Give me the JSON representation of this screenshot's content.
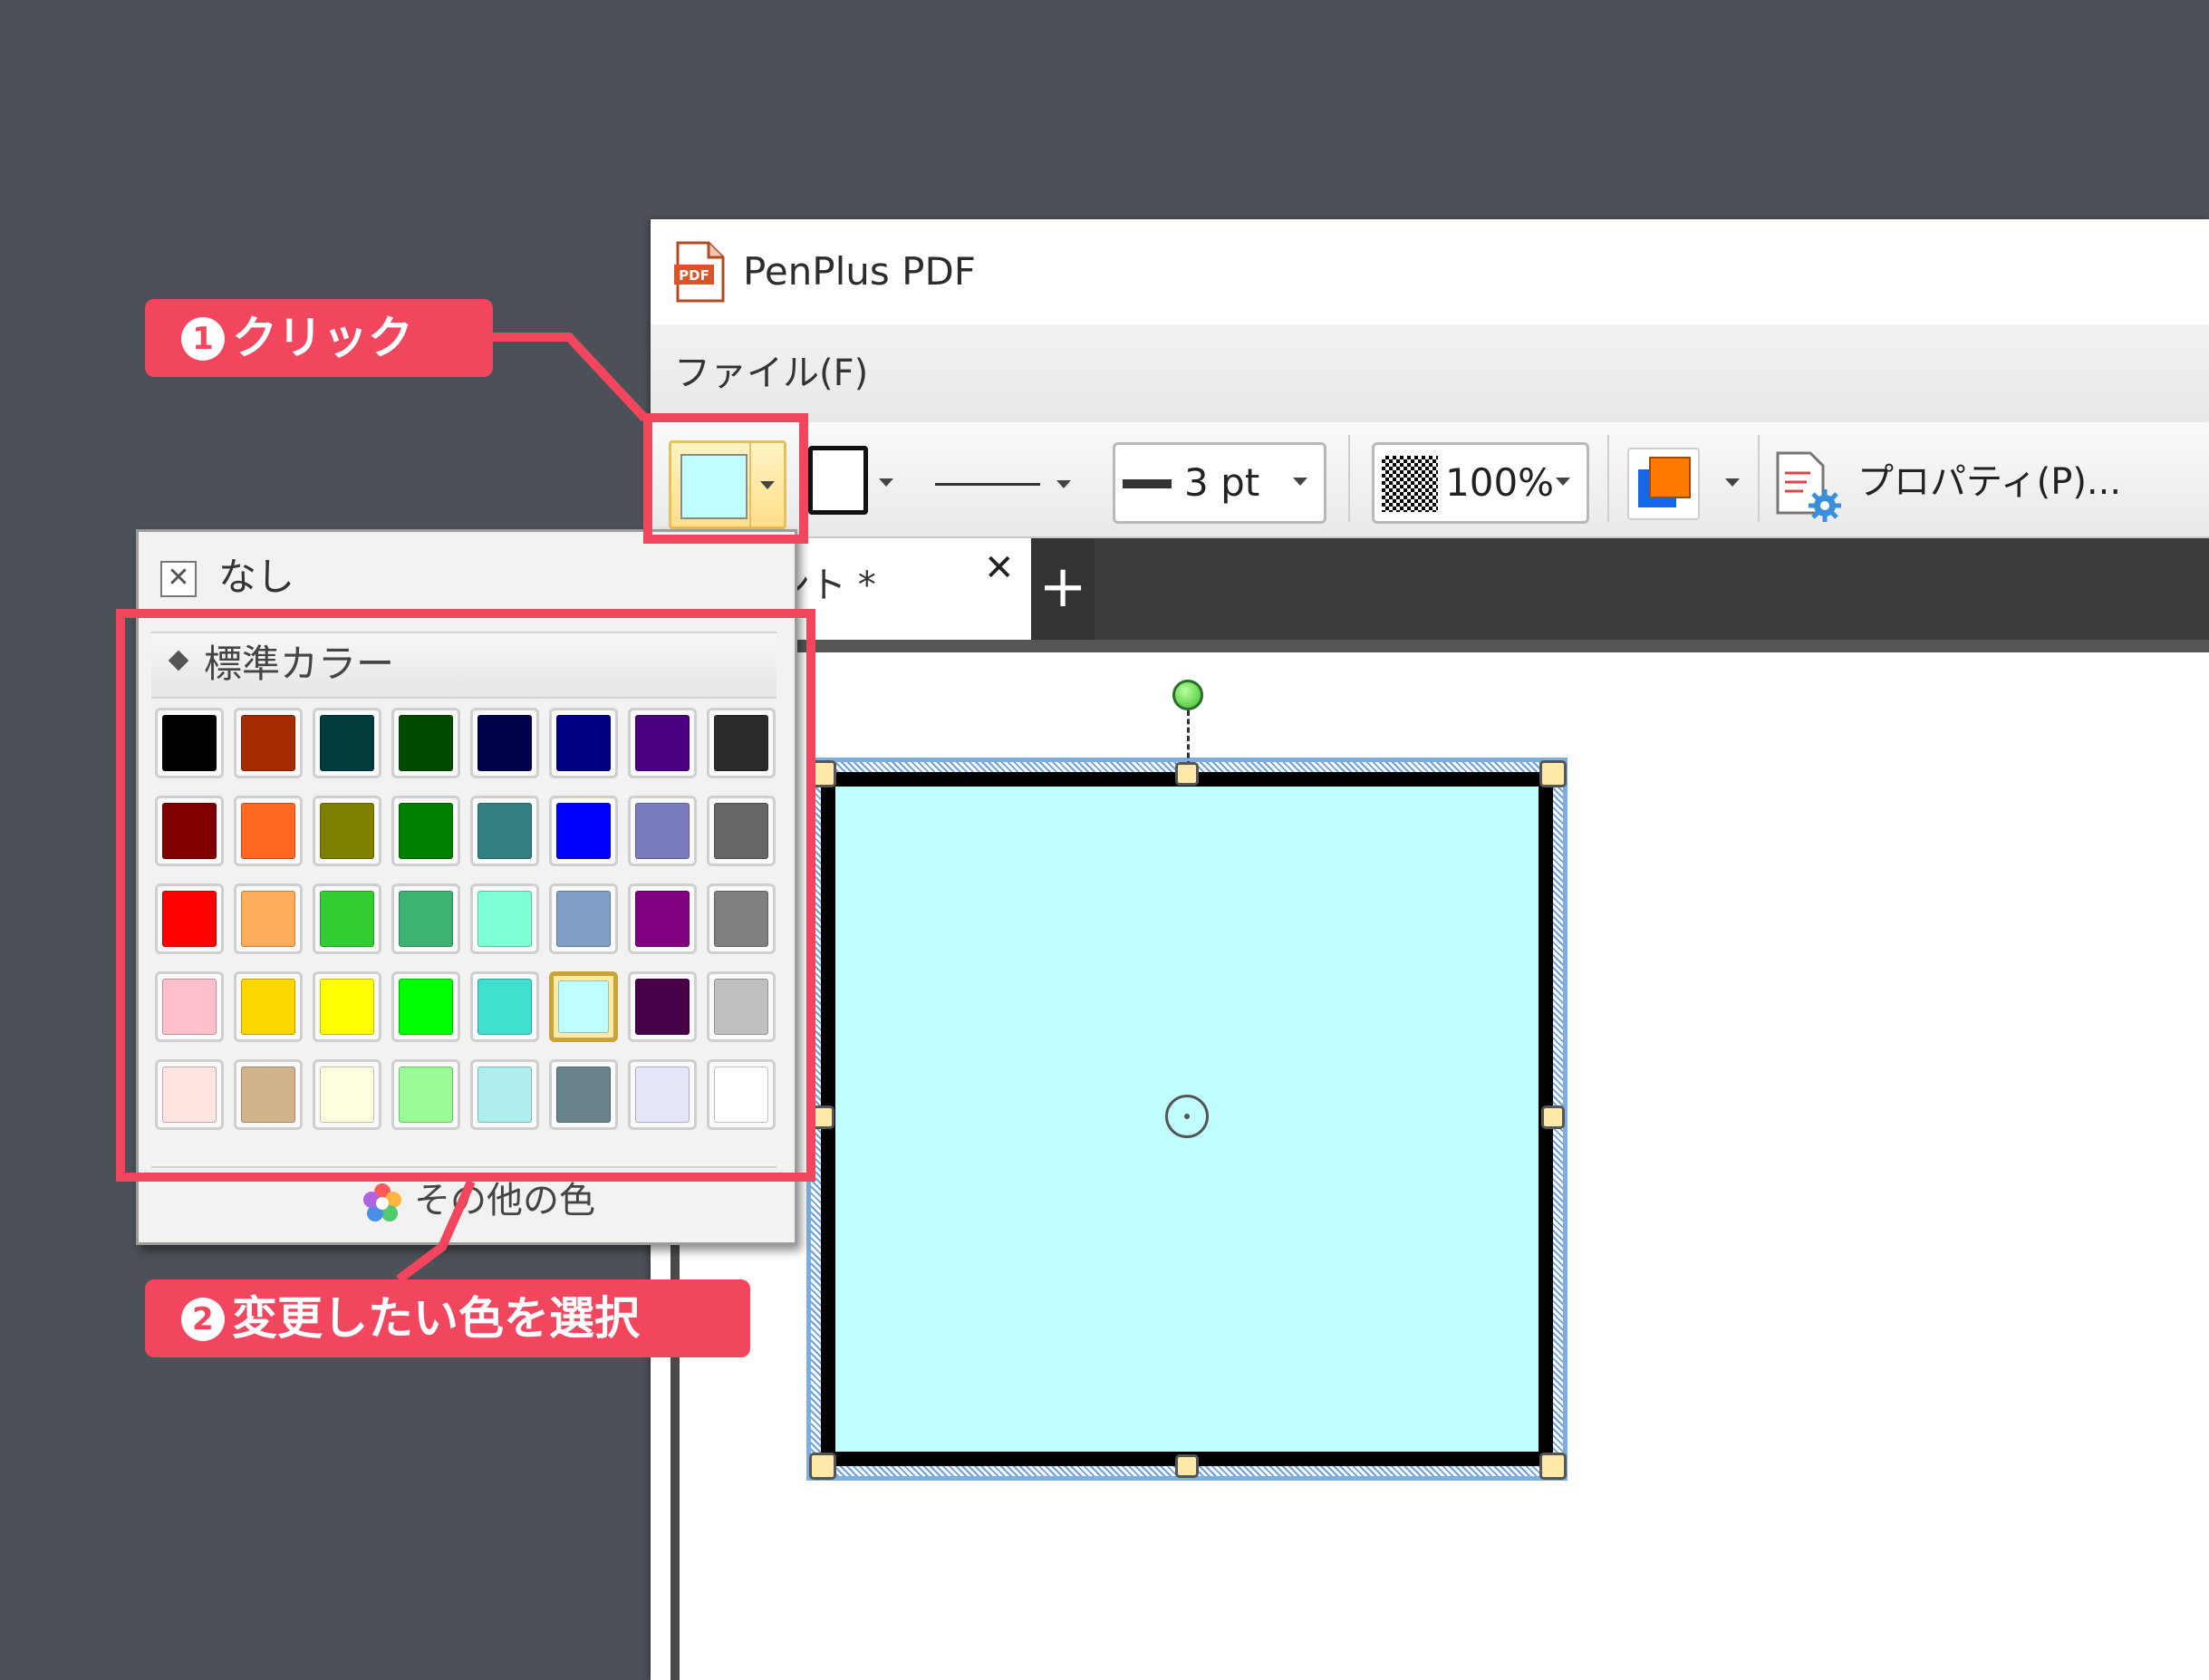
{
  "window": {
    "title": "PenPlus PDF",
    "app_icon": "pdf-app-icon"
  },
  "menu": {
    "file_label": "ファイル(F)"
  },
  "toolbar": {
    "fill_color": "#c0ffff",
    "line_color": "#000000",
    "line_width": "3 pt",
    "opacity": "100%",
    "properties_label": "プロパティ(P)..."
  },
  "tabs": {
    "document_label": "キュメント *",
    "close_glyph": "✕",
    "new_tab_glyph": "+"
  },
  "color_dropdown": {
    "none_label": "なし",
    "none_icon_glyph": "✕",
    "section_title": "標準カラー",
    "more_colors_label": "その他の色",
    "selected_color": "#c0ffff",
    "swatches": [
      [
        "#000000",
        "#a52a00",
        "#003c3c",
        "#004b00",
        "#00004b",
        "#000080",
        "#4b0082",
        "#2b2b2b"
      ],
      [
        "#800000",
        "#ff6820",
        "#808000",
        "#008000",
        "#338080",
        "#0000ff",
        "#7b7bc0",
        "#666666"
      ],
      [
        "#ff0000",
        "#ffad5b",
        "#32cd32",
        "#3cb371",
        "#7fffd4",
        "#7f9fc4",
        "#800080",
        "#7f7f7f"
      ],
      [
        "#ffc0cb",
        "#ffd700",
        "#ffff00",
        "#00ff00",
        "#40e0d0",
        "#c0ffff",
        "#480048",
        "#c0c0c0"
      ],
      [
        "#ffe4e1",
        "#d2b48c",
        "#ffffe0",
        "#98fb98",
        "#afeeee",
        "#68838b",
        "#e6e6fa",
        "#ffffff"
      ]
    ]
  },
  "shape": {
    "fill": "#c0ffff",
    "stroke": "#000000"
  },
  "annotations": {
    "step1_number": "1",
    "step1_text": "クリック",
    "step2_number": "2",
    "step2_text": "変更したい色を選択",
    "accent_color": "#f2465f"
  }
}
